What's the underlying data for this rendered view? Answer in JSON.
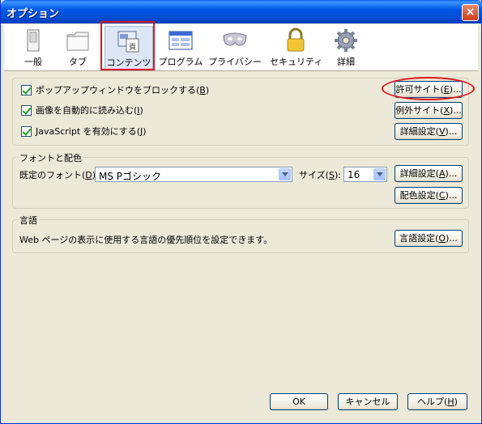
{
  "window": {
    "title": "オプション",
    "close": "×"
  },
  "toolbar": {
    "items": [
      {
        "label": "一般",
        "icon": "switch-icon"
      },
      {
        "label": "タブ",
        "icon": "folder-tabs-icon"
      },
      {
        "label": "コンテンツ",
        "icon": "contents-icon"
      },
      {
        "label": "プログラム",
        "icon": "programs-icon"
      },
      {
        "label": "プライバシー",
        "icon": "mask-icon"
      },
      {
        "label": "セキュリティ",
        "icon": "lock-icon"
      },
      {
        "label": "詳細",
        "icon": "gear-icon"
      }
    ],
    "selected_index": 2
  },
  "content": {
    "block_popups": {
      "label": "ポップアップウィンドウをブロックする(",
      "key": "B",
      "end": ")",
      "checked": true
    },
    "load_images": {
      "label": "画像を自動的に読み込む(",
      "key": "I",
      "end": ")",
      "checked": true
    },
    "enable_js": {
      "label": "JavaScript を有効にする(",
      "key": "J",
      "end": ")",
      "checked": true
    },
    "allowed_sites_button": {
      "label": "許可サイト(",
      "key": "E",
      "end": ")..."
    },
    "exceptions_button": {
      "label": "例外サイト(",
      "key": "X",
      "end": ")..."
    },
    "advanced_button": {
      "label": "詳細設定(",
      "key": "V",
      "end": ")..."
    }
  },
  "fonts": {
    "group_title": "フォントと配色",
    "default_font_label": "既定のフォント(",
    "default_font_key": "D",
    "default_font_end": "):",
    "default_font_value": "MS Pゴシック",
    "size_label": "サイズ(",
    "size_key": "S",
    "size_end": "):",
    "size_value": "16",
    "advanced_button": {
      "label": "詳細設定(",
      "key": "A",
      "end": ")..."
    },
    "colors_button": {
      "label": "配色設定(",
      "key": "C",
      "end": ")..."
    }
  },
  "languages": {
    "group_title": "言語",
    "description": "Web ページの表示に使用する言語の優先順位を設定できます。",
    "button": {
      "label": "言語設定(",
      "key": "O",
      "end": ")..."
    }
  },
  "footer": {
    "ok": "OK",
    "cancel": "キャンセル",
    "help_label": "ヘルプ(",
    "help_key": "H",
    "help_end": ")"
  },
  "colors": {
    "highlight_annotation": "#e0141d",
    "titlebar": "#0058e6",
    "dialog_bg": "#ece9d8"
  }
}
